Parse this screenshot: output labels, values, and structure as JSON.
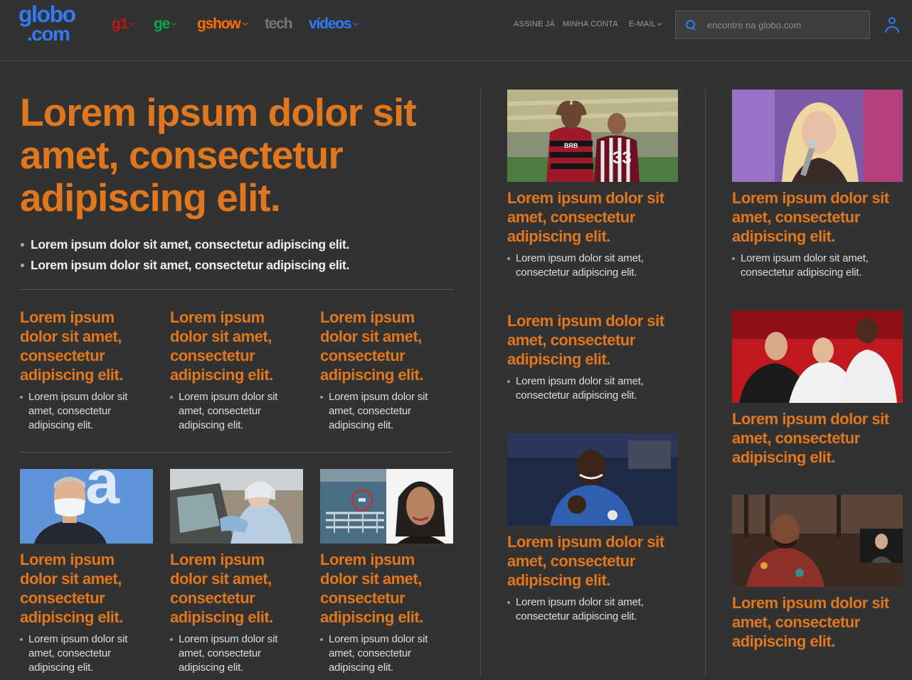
{
  "header": {
    "logo_line1": "globo",
    "logo_line2": ".com",
    "nav": [
      {
        "label": "g1",
        "color": "#c4170c"
      },
      {
        "label": "ge",
        "color": "#06aa48"
      },
      {
        "label": "gshow",
        "color": "#ff6d00"
      },
      {
        "label": "tech",
        "color": "#777777"
      },
      {
        "label": "vídeos",
        "color": "#2f7cf6"
      }
    ],
    "utility": {
      "subscribe": "ASSINE JÁ",
      "account": "MINHA CONTA",
      "email": "E-MAIL"
    },
    "search": {
      "placeholder": "encontre na globo.com"
    }
  },
  "lead": {
    "title": "Lorem ipsum dolor sit amet, consectetur adipiscing elit.",
    "bullets": [
      "Lorem ipsum dolor sit amet, consectetur adipiscing elit.",
      "Lorem ipsum dolor sit amet, consectetur adipiscing elit."
    ]
  },
  "left_row1": [
    {
      "title": "Lorem ipsum dolor sit amet, consectetur adipiscing elit.",
      "sub": "Lorem ipsum dolor sit amet, consectetur adipiscing elit."
    },
    {
      "title": "Lorem ipsum dolor sit amet, consectetur adipiscing elit.",
      "sub": "Lorem ipsum dolor sit amet, consectetur adipiscing elit."
    },
    {
      "title": "Lorem ipsum dolor sit amet, consectetur adipiscing elit.",
      "sub": "Lorem ipsum dolor sit amet, consectetur adipiscing elit."
    }
  ],
  "left_row2": [
    {
      "title": "Lorem ipsum dolor sit amet, consectetur adipiscing elit.",
      "sub": "Lorem ipsum dolor sit amet, consectetur adipiscing elit.",
      "photo_text": "a"
    },
    {
      "title": "Lorem ipsum dolor sit amet, consectetur adipiscing elit.",
      "sub": "Lorem ipsum dolor sit amet, consectetur adipiscing elit."
    },
    {
      "title": "Lorem ipsum dolor sit amet, consectetur adipiscing elit.",
      "sub": "Lorem ipsum dolor sit amet, consectetur adipiscing elit."
    }
  ],
  "middle": [
    {
      "title": "Lorem ipsum dolor sit amet, consectetur adipiscing elit.",
      "sub": "Lorem ipsum dolor sit amet, consectetur adipiscing elit.",
      "jersey_number": "33",
      "jersey_sponsor": "BRB"
    },
    {
      "title": "Lorem ipsum dolor sit amet, consectetur adipiscing elit.",
      "sub": "Lorem ipsum dolor sit amet, consectetur adipiscing elit."
    },
    {
      "title": "Lorem ipsum dolor sit amet, consectetur adipiscing elit.",
      "sub": "Lorem ipsum dolor sit amet, consectetur adipiscing elit."
    }
  ],
  "right": [
    {
      "title": "Lorem ipsum dolor sit amet, consectetur adipiscing elit.",
      "sub": "Lorem ipsum dolor sit amet, consectetur adipiscing elit."
    },
    {
      "title": "Lorem ipsum dolor sit amet, consectetur adipiscing elit."
    },
    {
      "title": "Lorem ipsum dolor sit amet, consectetur adipiscing elit."
    }
  ]
}
